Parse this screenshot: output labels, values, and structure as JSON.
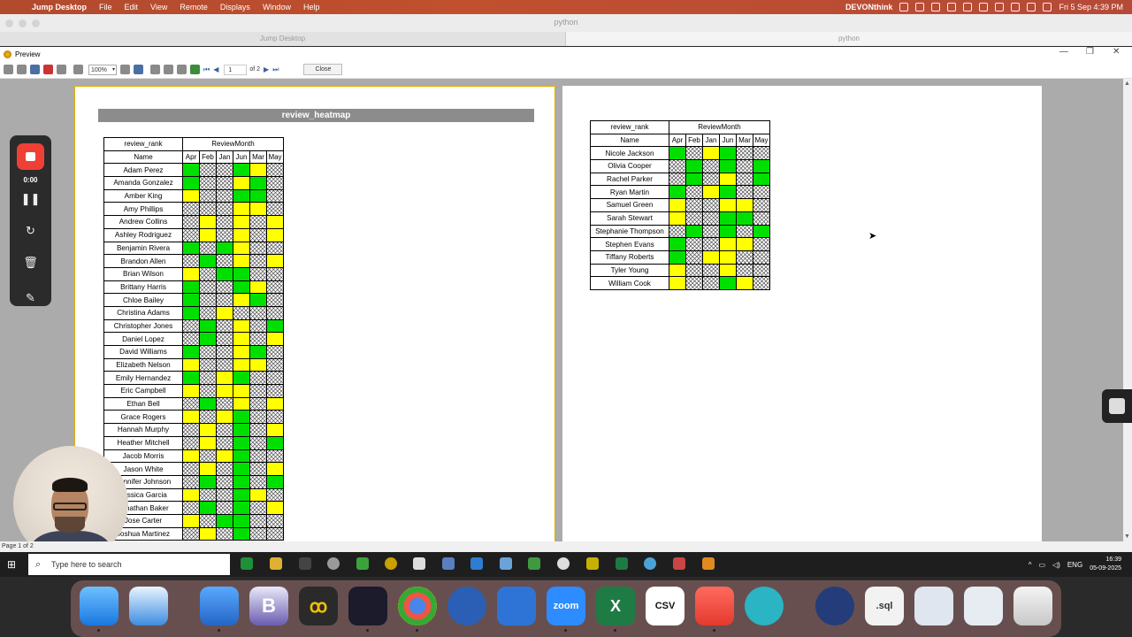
{
  "menubar": {
    "app_name": "Jump Desktop",
    "items": [
      "File",
      "Edit",
      "View",
      "Remote",
      "Displays",
      "Window",
      "Help"
    ],
    "right_app": "DEVONthink",
    "datetime": "Fri 5 Sep  4:39 PM"
  },
  "jump_window": {
    "title": "python",
    "tabs": [
      "Jump Desktop",
      "python"
    ]
  },
  "preview_window": {
    "title": "Preview",
    "toolbar": {
      "zoom": "100%",
      "page_input": "1",
      "of_pages": "of 2",
      "close_label": "Close"
    },
    "status": "Page 1 of 2"
  },
  "recorder": {
    "time": "0:00",
    "icons": [
      "stop-icon",
      "pause-icon",
      "restart-icon",
      "trash-icon",
      "pen-icon"
    ]
  },
  "report": {
    "title": "review_heatmap",
    "row_header": "review_rank",
    "col_group_header": "ReviewMonth",
    "name_header": "Name",
    "months": [
      "Apr",
      "Feb",
      "Jan",
      "Jun",
      "Mar",
      "May"
    ],
    "legend": {
      "G": "#00e000",
      "Y": "#ffff00",
      "X": "hatched"
    },
    "page1_rows": [
      {
        "name": "Adam Perez",
        "cells": "GXXGYX"
      },
      {
        "name": "Amanda Gonzalez",
        "cells": "GXXYGX"
      },
      {
        "name": "Amber King",
        "cells": "YXXGGX"
      },
      {
        "name": "Amy Phillips",
        "cells": "XXXYYX"
      },
      {
        "name": "Andrew Collins",
        "cells": "XYXYXY"
      },
      {
        "name": "Ashley Rodriguez",
        "cells": "XYXYXY"
      },
      {
        "name": "Benjamin Rivera",
        "cells": "GXGYXX"
      },
      {
        "name": "Brandon Allen",
        "cells": "XGXYXY"
      },
      {
        "name": "Brian Wilson",
        "cells": "YXGGXX"
      },
      {
        "name": "Brittany Harris",
        "cells": "GXXGYX"
      },
      {
        "name": "Chloe Bailey",
        "cells": "GXXYGX"
      },
      {
        "name": "Christina Adams",
        "cells": "GXYXXX"
      },
      {
        "name": "Christopher Jones",
        "cells": "XGXYXG"
      },
      {
        "name": "Daniel Lopez",
        "cells": "XGXYXY"
      },
      {
        "name": "David Williams",
        "cells": "GXXYGX"
      },
      {
        "name": "Elizabeth Nelson",
        "cells": "YXXYYX"
      },
      {
        "name": "Emily Hernandez",
        "cells": "GXYGXX"
      },
      {
        "name": "Eric Campbell",
        "cells": "YXYYXX"
      },
      {
        "name": "Ethan Bell",
        "cells": "XGXYXY"
      },
      {
        "name": "Grace Rogers",
        "cells": "YXYGXX"
      },
      {
        "name": "Hannah Murphy",
        "cells": "XYXGXY"
      },
      {
        "name": "Heather Mitchell",
        "cells": "XYXGXG"
      },
      {
        "name": "Jacob Morris",
        "cells": "YXYGXX"
      },
      {
        "name": "Jason White",
        "cells": "XYXGXY"
      },
      {
        "name": "Jennifer Johnson",
        "cells": "XGXGXG"
      },
      {
        "name": "Jessica Garcia",
        "cells": "YXXGYX"
      },
      {
        "name": "Jonathan Baker",
        "cells": "XGXGXY"
      },
      {
        "name": "Jose Carter",
        "cells": "YXGGXX"
      },
      {
        "name": "Joshua Martinez",
        "cells": "XYXGXX"
      }
    ],
    "page2_rows": [
      {
        "name": "Nicole Jackson",
        "cells": "GXYGXX"
      },
      {
        "name": "Olivia Cooper",
        "cells": "XGXGXG"
      },
      {
        "name": "Rachel Parker",
        "cells": "XGXYXG"
      },
      {
        "name": "Ryan Martin",
        "cells": "GXYGXX"
      },
      {
        "name": "Samuel Green",
        "cells": "YXXYYX"
      },
      {
        "name": "Sarah Stewart",
        "cells": "YXXGGX"
      },
      {
        "name": "Stephanie Thompson",
        "cells": "XGXGXG"
      },
      {
        "name": "Stephen Evans",
        "cells": "GXXYYX"
      },
      {
        "name": "Tiffany Roberts",
        "cells": "GXYYXX"
      },
      {
        "name": "Tyler Young",
        "cells": "YXXYXX"
      },
      {
        "name": "William Cook",
        "cells": "YXXGYX"
      }
    ]
  },
  "taskbar": {
    "search_placeholder": "Type here to search",
    "lang": "ENG",
    "time": "16:39",
    "date": "05-09-2025"
  },
  "dock": {
    "apps": [
      "Finder",
      "Safari",
      "Bookmarks",
      "BBEdit",
      "Lasso",
      "Jump Desktop",
      "Chrome",
      "1Password",
      "Xcode Tools",
      "Zoom",
      "Excel",
      "CSV Editor",
      "Cloud",
      "Spiral",
      "1Password 7",
      "sql",
      "Chrome Preview",
      "Preview",
      "Trash"
    ],
    "csv_label": "CSV",
    "zoom_label": "zoom",
    "sql_label": ".sql"
  }
}
